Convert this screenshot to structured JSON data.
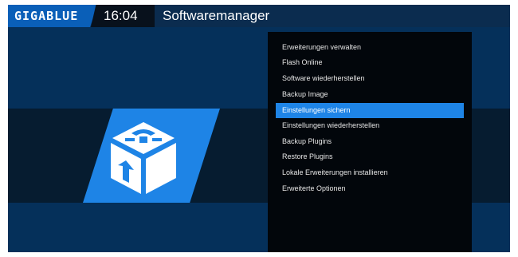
{
  "header": {
    "logo_text": "GIGABLUE",
    "clock": "16:04",
    "title": "Softwaremanager"
  },
  "menu": {
    "selected_index": 4,
    "items": [
      {
        "label": "Erweiterungen verwalten"
      },
      {
        "label": "Flash Online"
      },
      {
        "label": "Software wiederherstellen"
      },
      {
        "label": "Backup Image"
      },
      {
        "label": "Einstellungen sichern"
      },
      {
        "label": "Einstellungen wiederherstellen"
      },
      {
        "label": "Backup Plugins"
      },
      {
        "label": "Restore Plugins"
      },
      {
        "label": "Lokale Erweiterungen installieren"
      },
      {
        "label": "Erweiterte Optionen"
      }
    ]
  },
  "icons": {
    "plugin_icon": "software-package-cube-icon"
  },
  "colors": {
    "background": "#05305a",
    "accent": "#1e84e6",
    "menu_bg": "#02060b",
    "text": "#ffffff"
  }
}
